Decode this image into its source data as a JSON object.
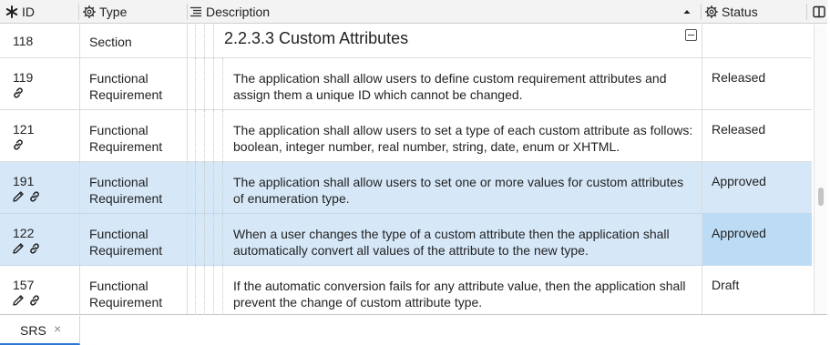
{
  "header": {
    "id_label": "ID",
    "type_label": "Type",
    "description_label": "Description",
    "status_label": "Status"
  },
  "section_row": {
    "id": "118",
    "type": "Section",
    "title": "2.2.3.3 Custom Attributes"
  },
  "rows": [
    {
      "id": "119",
      "type_line1": "Functional",
      "type_line2": "Requirement",
      "description": "The application shall allow users to define custom requirement attributes and assign them a unique ID which cannot be changed.",
      "status": "Released",
      "icons": [
        "link-icon"
      ],
      "selected": false
    },
    {
      "id": "121",
      "type_line1": "Functional",
      "type_line2": "Requirement",
      "description": "The application shall allow users to set a type of each custom attribute as follows: boolean, integer number, real number, string, date, enum or XHTML.",
      "status": "Released",
      "icons": [
        "link-icon"
      ],
      "selected": false
    },
    {
      "id": "191",
      "type_line1": "Functional",
      "type_line2": "Requirement",
      "description": "The application shall allow users to set one or more values for custom attributes of enumeration type.",
      "status": "Approved",
      "icons": [
        "pencil-icon",
        "link-icon"
      ],
      "selected": true
    },
    {
      "id": "122",
      "type_line1": "Functional",
      "type_line2": "Requirement",
      "description": "When a user changes the type of a custom attribute then the application shall automatically convert all values of the attribute to the new type.",
      "status": "Approved",
      "icons": [
        "pencil-icon",
        "link-icon"
      ],
      "selected": true
    },
    {
      "id": "157",
      "type_line1": "Functional",
      "type_line2": "Requirement",
      "description": "If the automatic conversion fails for any attribute value, then the application shall prevent the change of custom attribute type.",
      "status": "Draft",
      "icons": [
        "pencil-icon",
        "link-icon"
      ],
      "selected": false
    }
  ],
  "tabs": [
    {
      "label": "SRS",
      "close": "×"
    }
  ],
  "colors": {
    "selected_row": "#d6e8f8",
    "selected_cell": "#bcdcf5",
    "header_bg": "#f3f3f3",
    "tab_accent": "#2f78d2"
  }
}
